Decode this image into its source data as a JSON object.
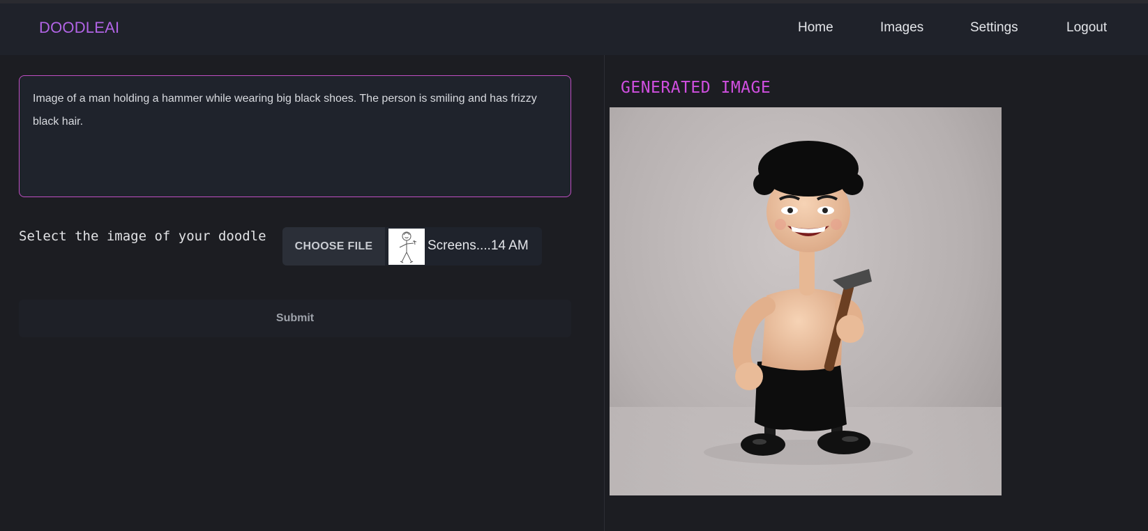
{
  "app": {
    "brand": "DOODLEAI",
    "colors": {
      "accent": "#b264e6",
      "title_accent": "#d04fe0",
      "border_accent": "#c04fc4",
      "background": "#1c1d22",
      "navbar": "#1f222a"
    }
  },
  "nav": {
    "home": "Home",
    "images": "Images",
    "settings": "Settings",
    "logout": "Logout"
  },
  "form": {
    "prompt_value": "Image of a man holding a hammer while wearing big black shoes. The person is smiling and has frizzy black hair.",
    "doodle_label": "Select the image of your doodle",
    "choose_file_label": "CHOOSE FILE",
    "file_name": "Screens....14 AM",
    "submit_label": "Submit"
  },
  "output": {
    "title": "GENERATED IMAGE"
  },
  "icons": {
    "thumbnail": "stick-figure-doodle-thumbnail",
    "generated": "cartoon-man-with-hammer-image"
  }
}
